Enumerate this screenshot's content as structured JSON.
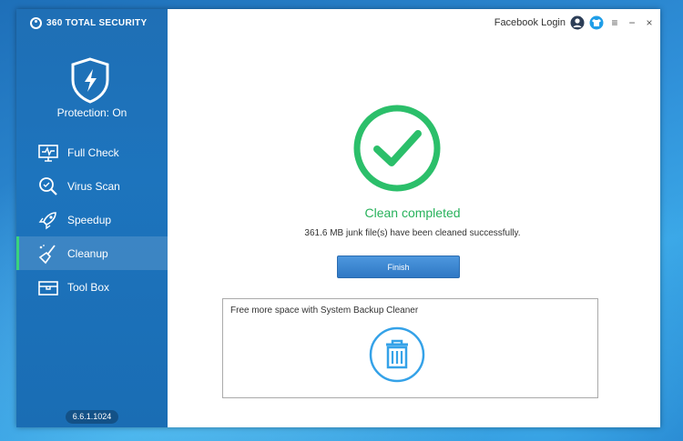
{
  "app": {
    "brand": "360 TOTAL SECURITY",
    "version": "6.6.1.1024"
  },
  "status": {
    "protection": "Protection: On"
  },
  "sidebar": {
    "items": [
      {
        "label": "Full Check",
        "icon": "monitor-pulse-icon"
      },
      {
        "label": "Virus Scan",
        "icon": "magnifier-icon"
      },
      {
        "label": "Speedup",
        "icon": "rocket-icon"
      },
      {
        "label": "Cleanup",
        "icon": "broom-icon",
        "active": true
      },
      {
        "label": "Tool Box",
        "icon": "toolbox-icon"
      }
    ]
  },
  "titlebar": {
    "login": "Facebook Login",
    "menu_glyph": "≡",
    "minimize_glyph": "−",
    "close_glyph": "×"
  },
  "result": {
    "title": "Clean completed",
    "detail": "361.6 MB junk file(s) have been cleaned successfully.",
    "finish_label": "Finish"
  },
  "backup": {
    "text": "Free more space with System Backup Cleaner"
  },
  "colors": {
    "accent_green": "#28b25c",
    "sidebar_blue": "#1d74bd",
    "icon_blue": "#35a2e8"
  }
}
